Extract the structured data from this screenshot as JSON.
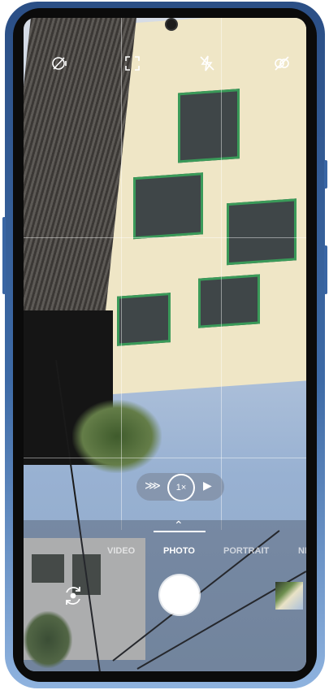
{
  "camera": {
    "top_icons": [
      "hdr-off-icon",
      "aspect-ratio-icon",
      "flash-off-icon",
      "live-filter-off-icon"
    ],
    "zoom": {
      "current": "1×",
      "left_icon": "wide-lens-icon",
      "right_icon": "telephoto-icon"
    },
    "modes": [
      {
        "label": "VIDEO",
        "active": false
      },
      {
        "label": "PHOTO",
        "active": true
      },
      {
        "label": "PORTRAIT",
        "active": false
      },
      {
        "label": "NIGH",
        "active": false
      }
    ],
    "bottom": {
      "left": "switch-camera-icon",
      "center": "shutter-button",
      "right": "gallery-thumbnail"
    }
  }
}
